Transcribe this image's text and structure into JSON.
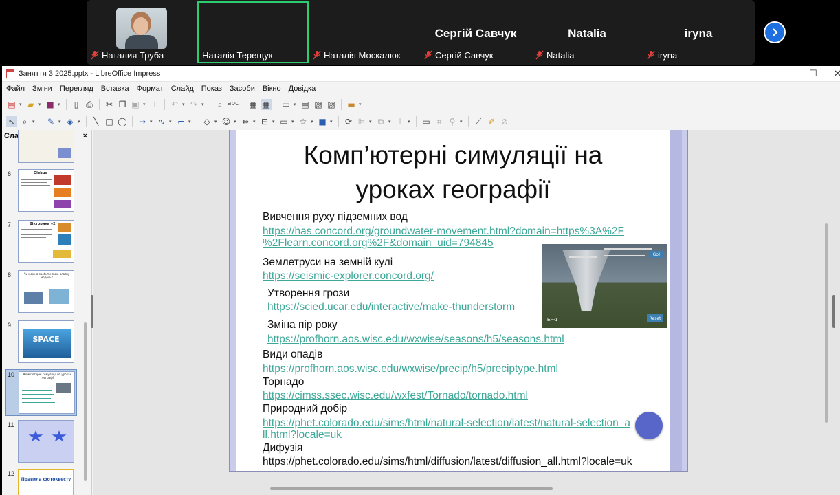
{
  "zoom": {
    "participants": [
      {
        "name": "Наталия Труба",
        "big_name": "",
        "has_video": true,
        "muted": true,
        "active": false
      },
      {
        "name": "Наталія Терещук",
        "big_name": "",
        "has_video": false,
        "muted": false,
        "active": true
      },
      {
        "name": "Наталія Москалюк",
        "big_name": "",
        "has_video": false,
        "muted": true,
        "active": false
      },
      {
        "name": "Сергій Савчук",
        "big_name": "Сергій Савчук",
        "has_video": false,
        "muted": true,
        "active": false
      },
      {
        "name": "Natalia",
        "big_name": "Natalia",
        "has_video": false,
        "muted": true,
        "active": false
      },
      {
        "name": "iryna",
        "big_name": "iryna",
        "has_video": false,
        "muted": true,
        "active": false
      }
    ],
    "next_icon": "chevron-right-icon",
    "accent_active": "#2ecc71",
    "accent_next": "#1e6fe0",
    "muted_color": "#e0413b"
  },
  "window": {
    "title": "Заняття 3  2025.pptx - LibreOffice Impress",
    "controls": [
      "–",
      "☐",
      "✕"
    ]
  },
  "menu": [
    "Файл",
    "Зміни",
    "Перегляд",
    "Вставка",
    "Формат",
    "Слайд",
    "Показ",
    "Засоби",
    "Вікно",
    "Довідка"
  ],
  "slides_panel": {
    "title": "Слайди",
    "close": "×",
    "thumbnails": [
      {
        "num": "6",
        "selected": false,
        "caption": "Globus"
      },
      {
        "num": "7",
        "selected": false,
        "caption": "Вікторина v2"
      },
      {
        "num": "8",
        "selected": false,
        "caption": "Чи можна зробити свою власну модель?"
      },
      {
        "num": "9",
        "selected": false,
        "caption": "SPACE"
      },
      {
        "num": "10",
        "selected": true,
        "caption": "Комп'ютерні симуляції на уроках географії"
      },
      {
        "num": "11",
        "selected": false,
        "caption": ""
      },
      {
        "num": "12",
        "selected": false,
        "caption": "Правила фотоквесту"
      }
    ]
  },
  "slide": {
    "title_line1": "Комп’ютерні симуляції на",
    "title_line2": "уроках географії",
    "items": [
      {
        "topic": "Вивчення руху підземних вод",
        "link1": "https://has.concord.org/groundwater-movement.html?domain=https%3A%2F",
        "link2": "%2Flearn.concord.org%2F&domain_uid=794845"
      },
      {
        "topic": "Землетруси на земній кулі",
        "link1": "https://seismic-explorer.concord.org/",
        "link2": ""
      },
      {
        "topic": "Утворення грози",
        "link1": "https://scied.ucar.edu/interactive/make-thunderstorm",
        "link2": ""
      },
      {
        "topic": "Зміна пір року",
        "link1": "https://profhorn.aos.wisc.edu/wxwise/seasons/h5/seasons.html",
        "link2": ""
      },
      {
        "topic": "Види опадів",
        "link1": "https://profhorn.aos.wisc.edu/wxwise/precip/h5/preciptype.html",
        "link2": ""
      },
      {
        "topic": "Торнадо",
        "link1": "https://cimss.ssec.wisc.edu/wxfest/Tornado/tornado.html",
        "link2": ""
      },
      {
        "topic": "Природний добір",
        "link1": "https://phet.colorado.edu/sims/html/natural-selection/latest/natural-selection_a",
        "link2": "ll.html?locale=uk"
      },
      {
        "topic": "Дифузія",
        "plain": "https://phet.colorado.edu/sims/html/diffusion/latest/diffusion_all.html?locale=uk"
      }
    ],
    "image": {
      "go_label": "Go!",
      "reset_label": "Reset",
      "scale_label": "EF-1"
    },
    "link_color": "#3ea898"
  }
}
